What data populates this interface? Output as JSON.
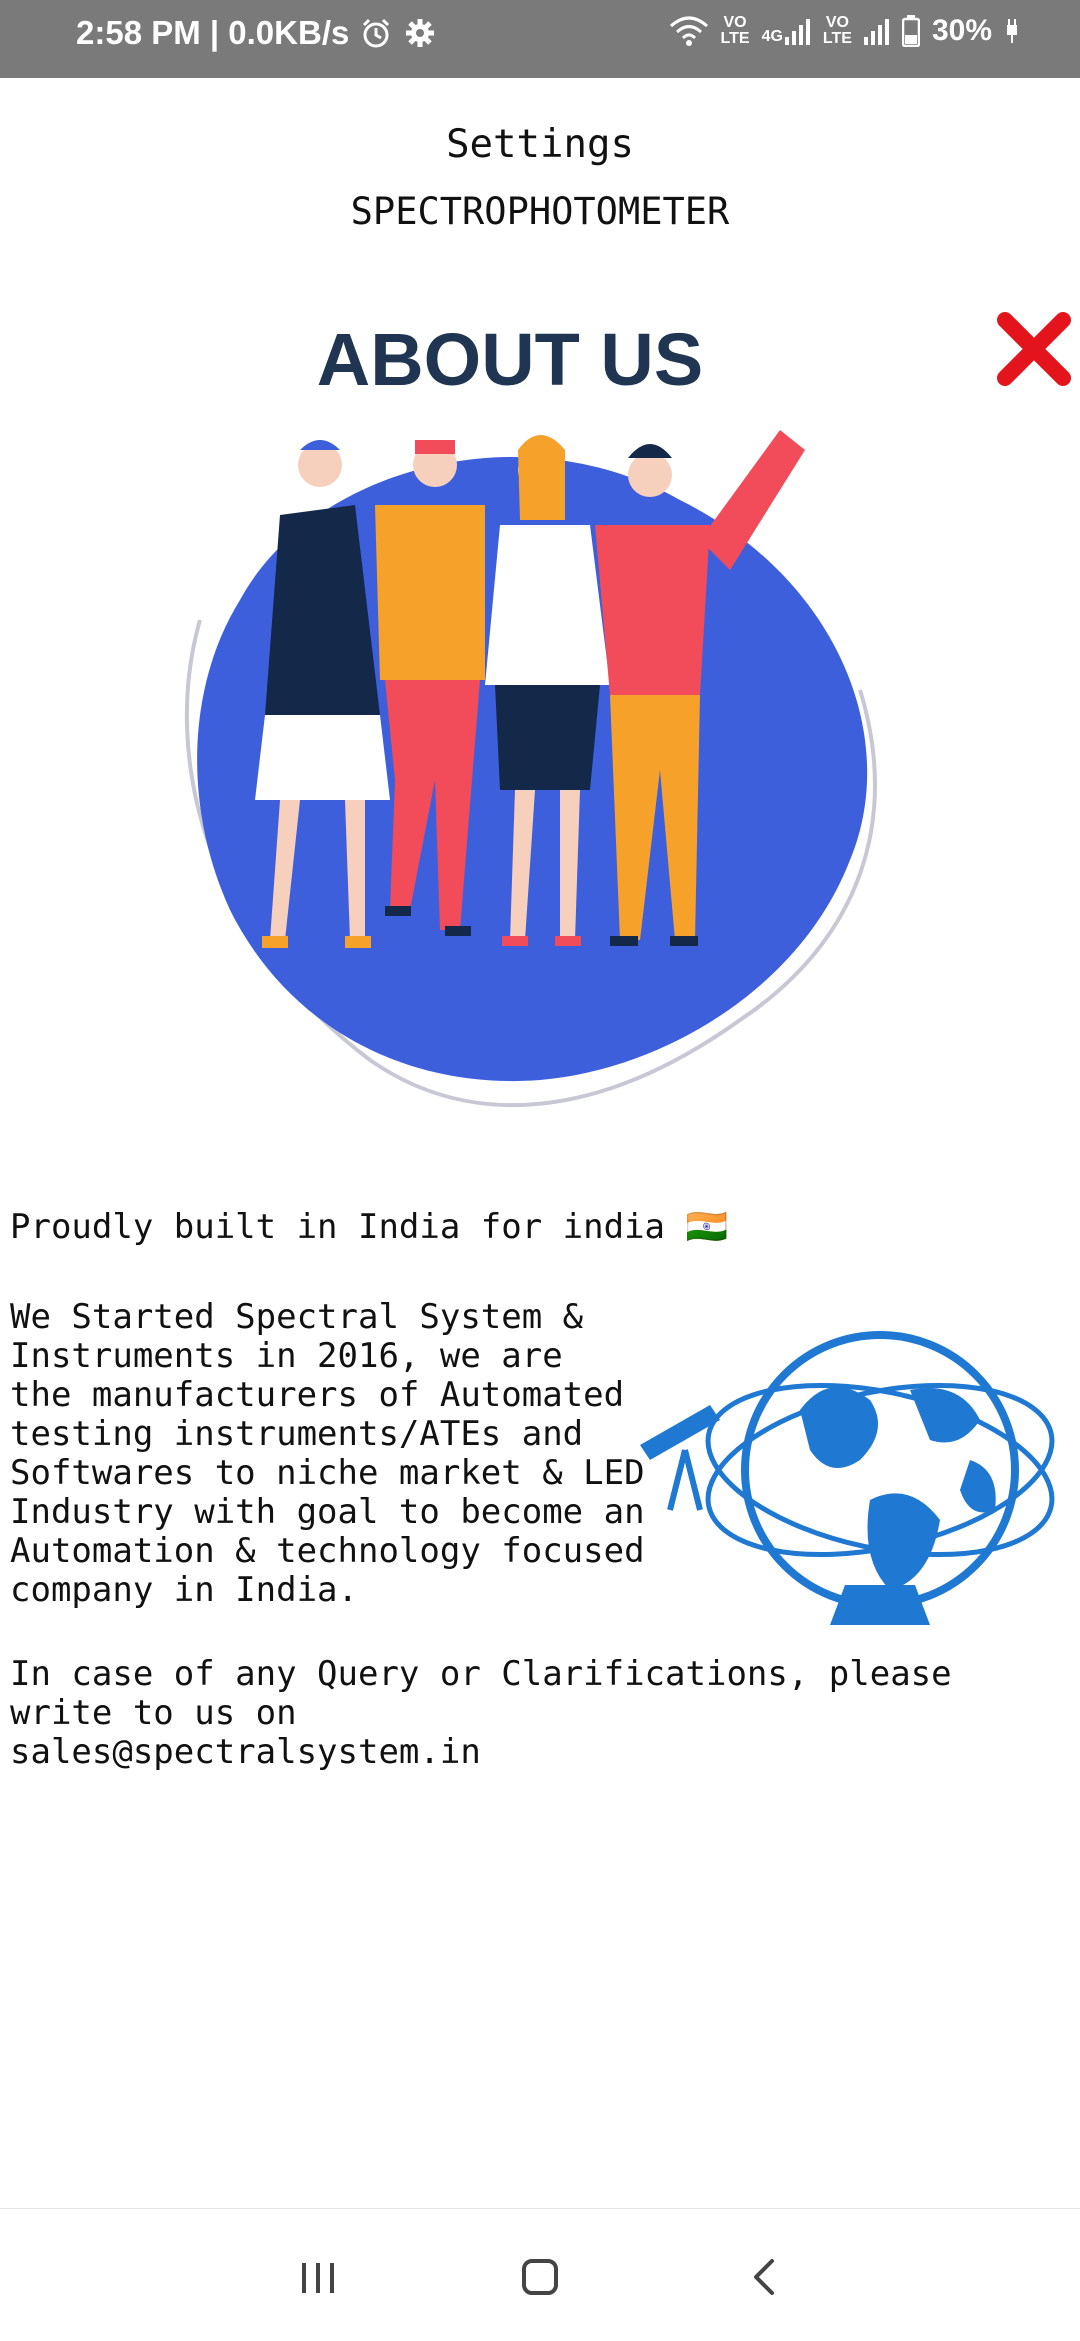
{
  "status_bar": {
    "time_speed": "2:58 PM | 0.0KB/s",
    "icons": [
      "alarm-icon",
      "gear-icon",
      "wifi-icon",
      "volte-icon",
      "signal-4g-icon",
      "volte-icon",
      "signal-icon",
      "battery-icon",
      "charging-icon"
    ],
    "volte_label": "VO\nLTE",
    "network_label": "4G",
    "battery": "30%"
  },
  "header": {
    "title": "Settings",
    "subtitle": "SPECTROPHOTOMETER"
  },
  "about_image": {
    "heading": "ABOUT US",
    "colors": {
      "blob": "#3d5fdc",
      "navy": "#14294a",
      "orange": "#f6a22a",
      "red": "#f24b5a"
    }
  },
  "content": {
    "proud_line": "Proudly built in India for india 🇮🇳",
    "about_paragraph": "We Started Spectral System &\nInstruments in 2016, we are\nthe manufacturers of Automated\ntesting instruments/ATEs and\nSoftwares to niche market & LED\nIndustry with goal to become an\nAutomation & technology focused\ncompany in India.",
    "query_line": "In case of any Query or Clarifications, please write to us on",
    "email": "sales@spectralsystem.in"
  },
  "navbar": {
    "icons": [
      "recents-icon",
      "home-icon",
      "back-icon"
    ]
  }
}
